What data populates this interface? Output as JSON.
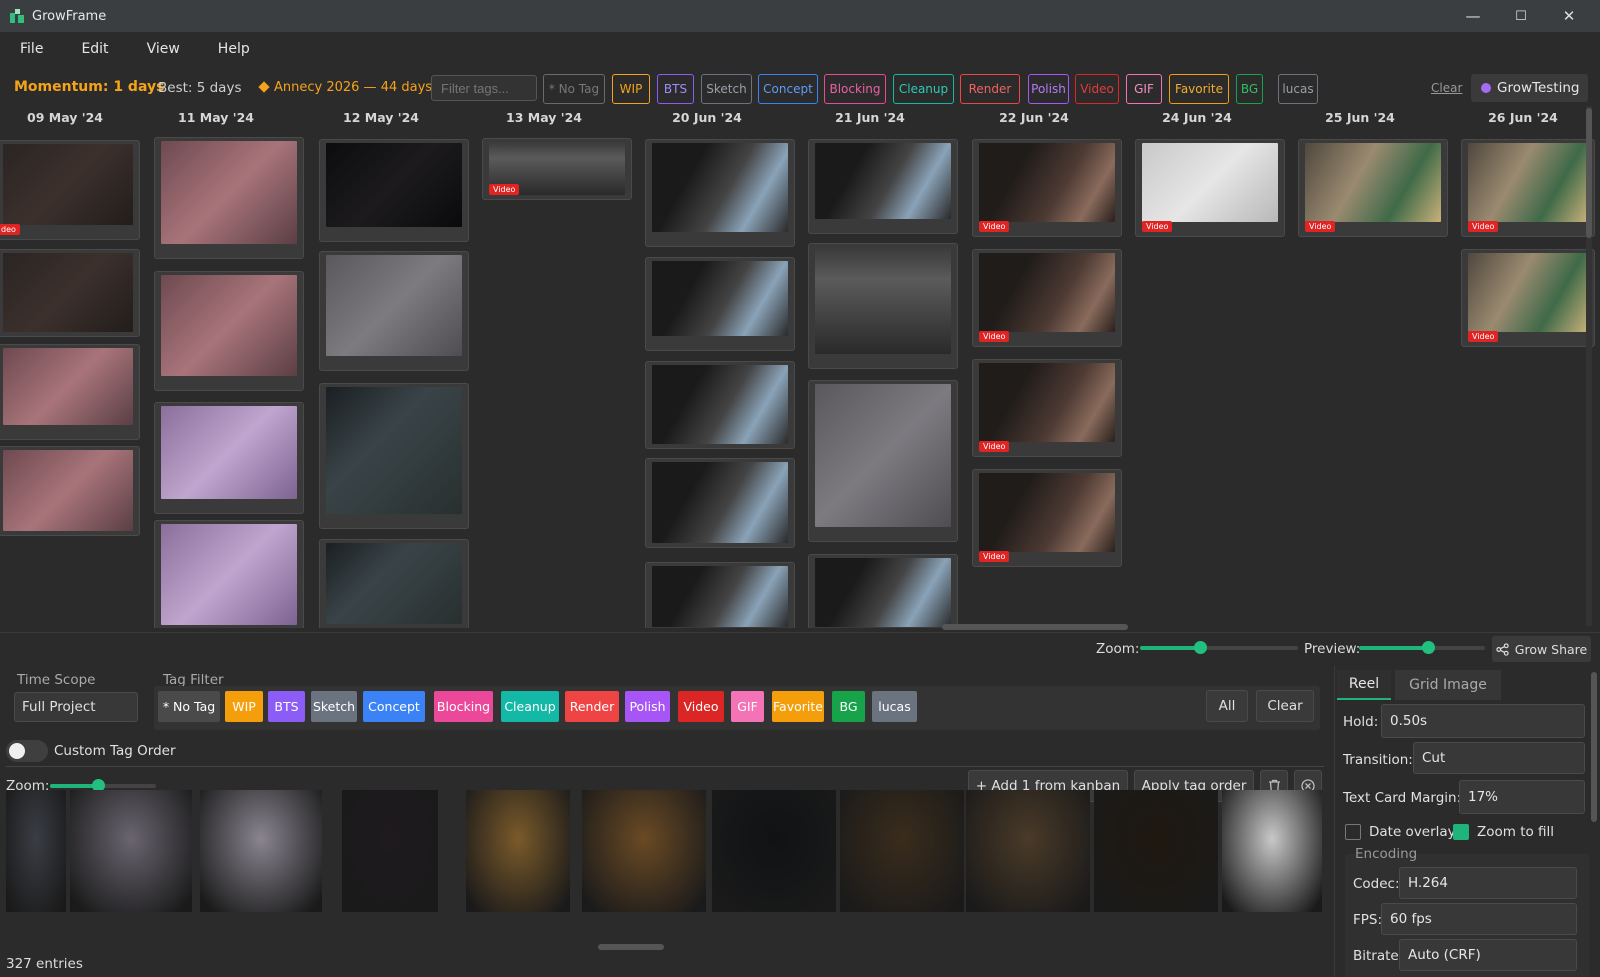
{
  "app": {
    "title": "GrowFrame"
  },
  "window_controls": {
    "minimize": "—",
    "maximize": "☐",
    "close": "✕"
  },
  "menu": [
    "File",
    "Edit",
    "View",
    "Help"
  ],
  "stats": {
    "momentum": "Momentum: 1 days",
    "best": "Best: 5 days",
    "deadline": "Annecy 2026 — 44 days",
    "filter_placeholder": "Filter tags...",
    "clear": "Clear",
    "workspace": "GrowTesting"
  },
  "top_tags": [
    {
      "label": "* No Tag",
      "color": "#6a6a6a",
      "text": "#777"
    },
    {
      "label": "WIP",
      "color": "#f5a31a",
      "text": "#f5a31a"
    },
    {
      "label": "BTS",
      "color": "#8b5cf6",
      "text": "#a48bf8"
    },
    {
      "label": "Sketch",
      "color": "#6b7280",
      "text": "#9aa0a8"
    },
    {
      "label": "Concept",
      "color": "#3b82f6",
      "text": "#5f9cf8"
    },
    {
      "label": "Blocking",
      "color": "#ec4899",
      "text": "#ec5fa6"
    },
    {
      "label": "Cleanup",
      "color": "#14b8a6",
      "text": "#2ccbb8"
    },
    {
      "label": "Render",
      "color": "#ef4444",
      "text": "#f26262"
    },
    {
      "label": "Polish",
      "color": "#a855f7",
      "text": "#b77af8"
    },
    {
      "label": "Video",
      "color": "#dc2626",
      "text": "#e53b3b"
    },
    {
      "label": "GIF",
      "color": "#f472b6",
      "text": "#f68cc2"
    },
    {
      "label": "Favorite",
      "color": "#f59e0b",
      "text": "#f5ac30"
    },
    {
      "label": "BG",
      "color": "#16a34a",
      "text": "#2fbf64"
    },
    {
      "label": "lucas",
      "color": "#6b7280",
      "text": "#9aa0a8"
    }
  ],
  "columns": [
    "09 May '24",
    "11 May '24",
    "12 May '24",
    "13 May '24",
    "20 Jun '24",
    "21 Jun '24",
    "22 Jun '24",
    "24 Jun '24",
    "25 Jun '24",
    "26 Jun '24"
  ],
  "badges": {
    "video": "Video",
    "video_cut": "deo"
  },
  "zoombar": {
    "zoom": "Zoom:",
    "preview": "Preview:",
    "share": "Grow Share",
    "zoom_value": 0.38,
    "preview_value": 0.55
  },
  "bottom": {
    "time_scope_label": "Time Scope",
    "time_scope_value": "Full Project",
    "tag_filter_label": "Tag Filter",
    "all": "All",
    "clear": "Clear",
    "custom_tag_order": "Custom Tag Order",
    "zoom": "Zoom:",
    "zoom_value": 0.45,
    "add_from_kanban": "+ Add 1 from kanban",
    "apply_tag_order": "Apply tag order",
    "entries": "327 entries"
  },
  "filter_tags": [
    {
      "label": "* No Tag",
      "color": "#4a4a4a"
    },
    {
      "label": "WIP",
      "color": "#f59e0b"
    },
    {
      "label": "BTS",
      "color": "#8b5cf6"
    },
    {
      "label": "Sketch",
      "color": "#6b7280"
    },
    {
      "label": "Concept",
      "color": "#3b82f6"
    },
    {
      "label": "Blocking",
      "color": "#ec4899"
    },
    {
      "label": "Cleanup",
      "color": "#14b8a6"
    },
    {
      "label": "Render",
      "color": "#ef4444"
    },
    {
      "label": "Polish",
      "color": "#a855f7"
    },
    {
      "label": "Video",
      "color": "#dc2626"
    },
    {
      "label": "GIF",
      "color": "#f472b6"
    },
    {
      "label": "Favorite",
      "color": "#f59e0b"
    },
    {
      "label": "BG",
      "color": "#16a34a"
    },
    {
      "label": "lucas",
      "color": "#6b7280"
    }
  ],
  "reel": {
    "tabs": [
      "Reel",
      "Grid Image"
    ],
    "hold_label": "Hold:",
    "hold_value": "0.50s",
    "transition_label": "Transition:",
    "transition_value": "Cut",
    "margin_label": "Text Card Margin:",
    "margin_value": "17%",
    "date_overlay": "Date overlay",
    "date_overlay_checked": false,
    "zoom_to_fill": "Zoom to fill",
    "zoom_to_fill_checked": true,
    "encoding_label": "Encoding",
    "codec_label": "Codec:",
    "codec_value": "H.264",
    "fps_label": "FPS:",
    "fps_value": "60 fps",
    "bitrate_label": "Bitrate:",
    "bitrate_value": "Auto (CRF)"
  },
  "accent": "#1fb47a"
}
